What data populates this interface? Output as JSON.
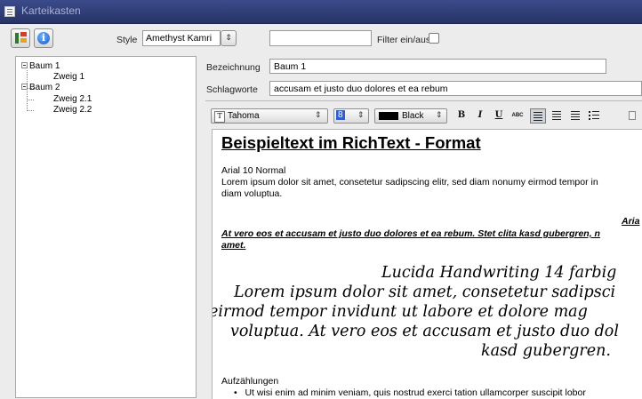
{
  "window": {
    "title": "Karteikasten"
  },
  "toolbar": {
    "style_label": "Style",
    "style_value": "Amethyst Kamri",
    "filter_value": "",
    "filter_label": "Filter ein/aus"
  },
  "tree": {
    "nodes": [
      "Baum 1",
      "Zweig 1",
      "Baum 2",
      "Zweig 2.1",
      "Zweig 2.2"
    ]
  },
  "form": {
    "bezeichnung_label": "Bezeichnung",
    "bezeichnung_value": "Baum 1",
    "schlagworte_label": "Schlagworte",
    "schlagworte_value": "accusam et justo duo dolores et ea rebum"
  },
  "format_toolbar": {
    "font": "Tahoma",
    "size": "8",
    "color_name": "Black",
    "color_hex": "#000000",
    "bold": "B",
    "italic": "I",
    "underline": "U",
    "abc": "ABC"
  },
  "document": {
    "heading": "Beispieltext im RichText - Format",
    "p1_title": "Arial 10 Normal",
    "p1_line1": "Lorem ipsum dolor sit amet, consetetur sadipscing elitr, sed diam nonumy eirmod tempor in",
    "p1_line2": "diam voluptua.",
    "p2_title": "Aria",
    "p2_line1": "At vero eos et accusam et justo duo dolores et ea rebum. Stet clita kasd gubergren, n",
    "p2_line2": "amet.",
    "script_1": "Lucida Handwriting 14 farbig",
    "script_2": "Lorem ipsum dolor sit amet, consetetur sadipsci",
    "script_3": "eirmod tempor invidunt ut labore et dolore mag",
    "script_4": "voluptua. At vero eos et accusam et justo duo dol",
    "script_5": "kasd gubergren.",
    "list_title": "Aufzählungen",
    "list_item_1": "Ut wisi enim ad minim veniam, quis nostrud exerci tation ullamcorper suscipit lobor"
  },
  "colors": {
    "titlebar": "#2f3c78",
    "background": "#ececec"
  }
}
